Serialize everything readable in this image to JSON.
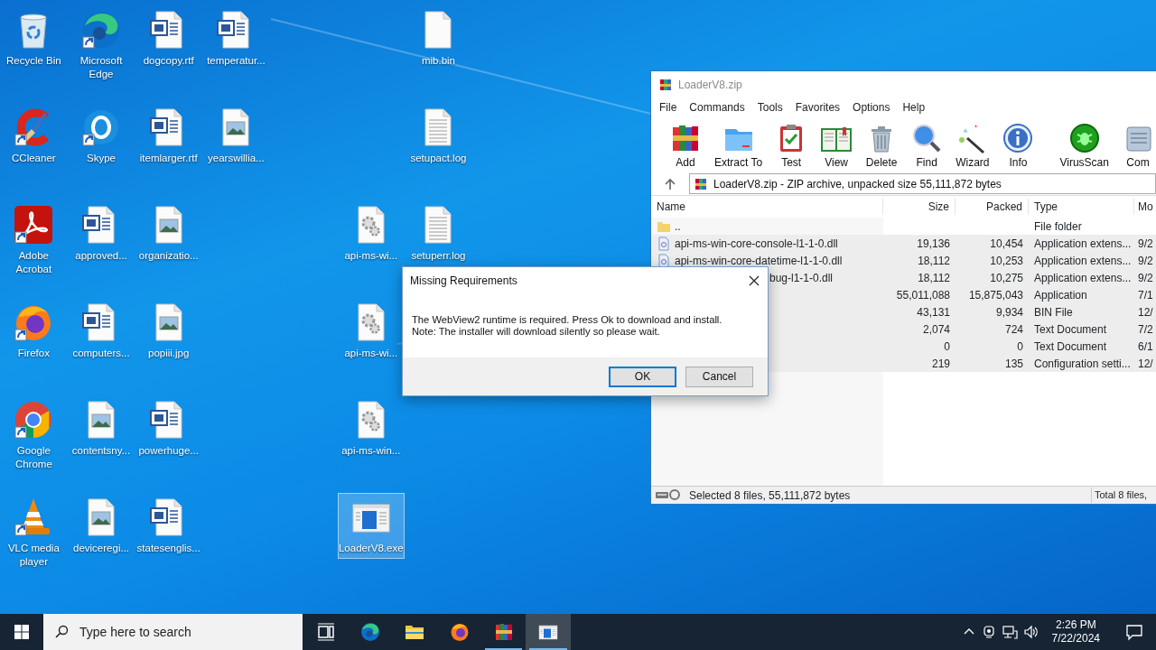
{
  "desktop": {
    "columns": [
      [
        {
          "label": "Recycle Bin",
          "kind": "recycle",
          "shortcut": false,
          "selected": false
        },
        {
          "label": "CCleaner",
          "kind": "ccleaner",
          "shortcut": true,
          "selected": false
        },
        {
          "label": "Adobe Acrobat",
          "kind": "acrobat",
          "shortcut": true,
          "selected": false
        },
        {
          "label": "Firefox",
          "kind": "firefox",
          "shortcut": true,
          "selected": false
        },
        {
          "label": "Google Chrome",
          "kind": "chrome",
          "shortcut": true,
          "selected": false
        },
        {
          "label": "VLC media player",
          "kind": "vlc",
          "shortcut": true,
          "selected": false
        }
      ],
      [
        {
          "label": "Microsoft Edge",
          "kind": "edge",
          "shortcut": true,
          "selected": false
        },
        {
          "label": "Skype",
          "kind": "skype",
          "shortcut": true,
          "selected": false
        },
        {
          "label": "approved...",
          "kind": "word",
          "shortcut": false,
          "selected": false
        },
        {
          "label": "computers...",
          "kind": "word",
          "shortcut": false,
          "selected": false
        },
        {
          "label": "contentsny...",
          "kind": "image",
          "shortcut": false,
          "selected": false
        },
        {
          "label": "deviceregi...",
          "kind": "image",
          "shortcut": false,
          "selected": false
        }
      ],
      [
        {
          "label": "dogcopy.rtf",
          "kind": "word",
          "shortcut": false,
          "selected": false
        },
        {
          "label": "itemlarger.rtf",
          "kind": "word",
          "shortcut": false,
          "selected": false
        },
        {
          "label": "organizatio...",
          "kind": "image",
          "shortcut": false,
          "selected": false
        },
        {
          "label": "popiii.jpg",
          "kind": "image",
          "shortcut": false,
          "selected": false
        },
        {
          "label": "powerhuge...",
          "kind": "word",
          "shortcut": false,
          "selected": false
        },
        {
          "label": "statesenglis...",
          "kind": "word",
          "shortcut": false,
          "selected": false
        }
      ],
      [
        {
          "label": "temperatur...",
          "kind": "word",
          "shortcut": false,
          "selected": false
        },
        {
          "label": "yearswillia...",
          "kind": "image",
          "shortcut": false,
          "selected": false
        }
      ],
      [],
      [
        null,
        null,
        {
          "label": "api-ms-wi...",
          "kind": "gear",
          "shortcut": false,
          "selected": false
        },
        {
          "label": "api-ms-wi...",
          "kind": "gear",
          "shortcut": false,
          "selected": false
        },
        {
          "label": "api-ms-win...",
          "kind": "gear",
          "shortcut": false,
          "selected": false
        },
        {
          "label": "LoaderV8.exe",
          "kind": "exe",
          "shortcut": false,
          "selected": true
        }
      ],
      [
        {
          "label": "mib.bin",
          "kind": "blank",
          "shortcut": false,
          "selected": false
        },
        {
          "label": "setupact.log",
          "kind": "text",
          "shortcut": false,
          "selected": false
        },
        {
          "label": "setuperr.log",
          "kind": "text",
          "shortcut": false,
          "selected": false
        }
      ]
    ]
  },
  "archiver": {
    "title": "LoaderV8.zip",
    "menu": [
      "File",
      "Commands",
      "Tools",
      "Favorites",
      "Options",
      "Help"
    ],
    "toolbar": [
      {
        "label": "Add",
        "kind": "add"
      },
      {
        "label": "Extract To",
        "kind": "extract"
      },
      {
        "label": "Test",
        "kind": "test"
      },
      {
        "label": "View",
        "kind": "view"
      },
      {
        "label": "Delete",
        "kind": "delete"
      },
      {
        "label": "Find",
        "kind": "find"
      },
      {
        "label": "Wizard",
        "kind": "wizard"
      },
      {
        "label": "Info",
        "kind": "info"
      },
      {
        "label": "VirusScan",
        "kind": "virus"
      },
      {
        "label": "Com",
        "kind": "comment"
      }
    ],
    "address": "LoaderV8.zip - ZIP archive, unpacked size 55,111,872 bytes",
    "columns": [
      "Name",
      "Size",
      "Packed",
      "Type",
      "Mo"
    ],
    "rows": [
      {
        "kind": "folder",
        "name": "..",
        "type": "File folder",
        "selected": false
      },
      {
        "kind": "dll",
        "name": "api-ms-win-core-console-l1-1-0.dll",
        "size": "19,136",
        "packed": "10,454",
        "type": "Application extens...",
        "column_5": "9/2",
        "selected": true
      },
      {
        "kind": "dll",
        "name": "api-ms-win-core-datetime-l1-1-0.dll",
        "size": "18,112",
        "packed": "10,253",
        "type": "Application extens...",
        "column_5": "9/2",
        "selected": true
      },
      {
        "name": "bug-l1-1-0.dll",
        "cut": true,
        "size": "18,112",
        "packed": "10,275",
        "type": "Application extens...",
        "column_5": "9/2",
        "selected": true
      },
      {
        "size": "55,011,088",
        "packed": "15,875,043",
        "type": "Application",
        "column_5": "7/1",
        "selected": true
      },
      {
        "size": "43,131",
        "packed": "9,934",
        "type": "BIN File",
        "column_5": "12/",
        "selected": true
      },
      {
        "size": "2,074",
        "packed": "724",
        "type": "Text Document",
        "column_5": "7/2",
        "selected": true
      },
      {
        "size": "0",
        "packed": "0",
        "type": "Text Document",
        "column_5": "6/1",
        "selected": true
      },
      {
        "size": "219",
        "packed": "135",
        "type": "Configuration setti...",
        "column_5": "12/",
        "selected": true
      }
    ],
    "status_left": "Selected 8 files, 55,111,872 bytes",
    "status_right": "Total 8 files,"
  },
  "dialog": {
    "title": "Missing Requirements",
    "message": "The WebView2 runtime is required. Press Ok to download and install.\nNote: The installer will download silently so please wait.",
    "buttons": [
      {
        "label": "OK",
        "default": true
      },
      {
        "label": "Cancel",
        "default": false
      }
    ]
  },
  "taskbar": {
    "search": {
      "placeholder": "Type here to search"
    },
    "apps": [
      {
        "kind": "taskview",
        "running": false,
        "active": false
      },
      {
        "kind": "edge",
        "running": false,
        "active": false
      },
      {
        "kind": "explorer",
        "running": false,
        "active": false
      },
      {
        "kind": "firefox",
        "running": false,
        "active": false
      },
      {
        "kind": "winrar",
        "running": true,
        "active": false
      },
      {
        "kind": "loader",
        "running": true,
        "active": true
      }
    ],
    "time": "2:26 PM",
    "date": "7/22/2024"
  }
}
